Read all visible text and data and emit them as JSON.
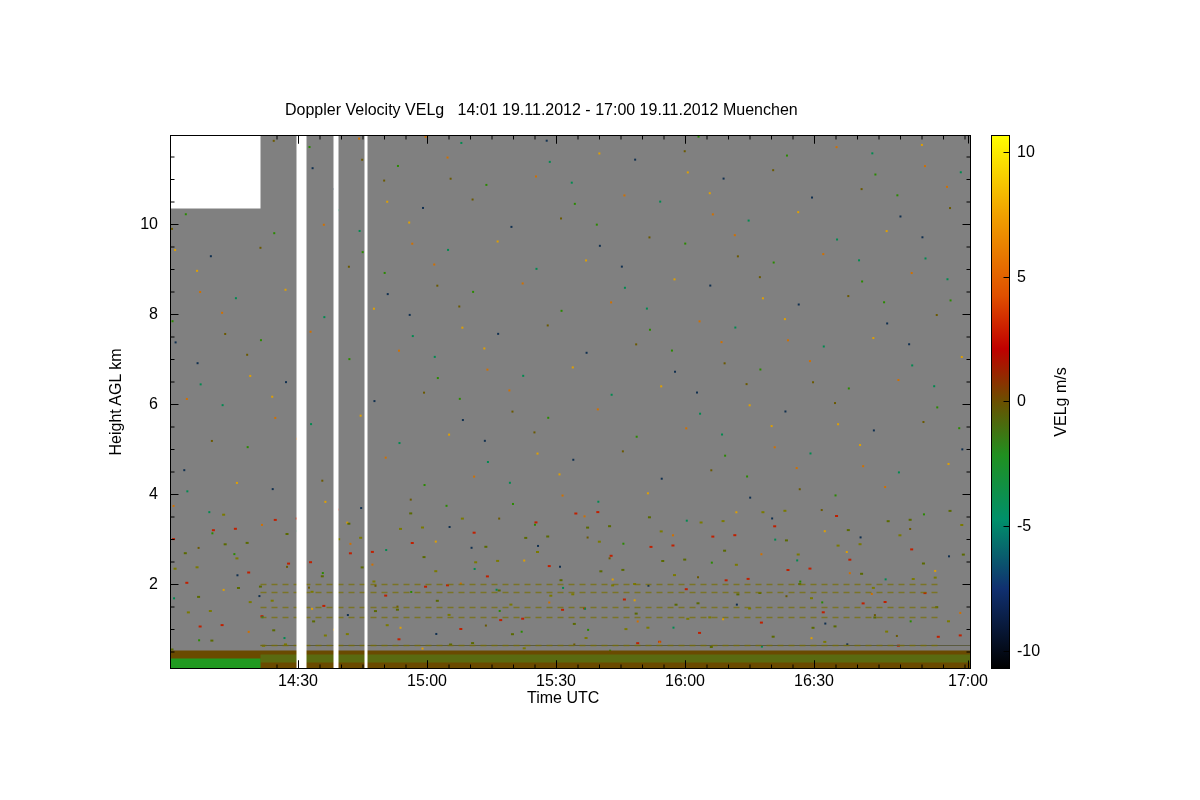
{
  "title": "Doppler Velocity VELg   14:01 19.11.2012 - 17:00 19.11.2012 Muenchen",
  "y_axis": {
    "label": "Height AGL km",
    "ticks": [
      "10",
      "8",
      "6",
      "4",
      "2"
    ]
  },
  "x_axis": {
    "label": "Time UTC",
    "ticks": [
      "14:30",
      "15:00",
      "15:30",
      "16:00",
      "16:30",
      "17:00"
    ]
  },
  "colorbar": {
    "label": "VELg m/s",
    "ticks": [
      "10",
      "5",
      "0",
      "-5",
      "-10"
    ]
  }
}
